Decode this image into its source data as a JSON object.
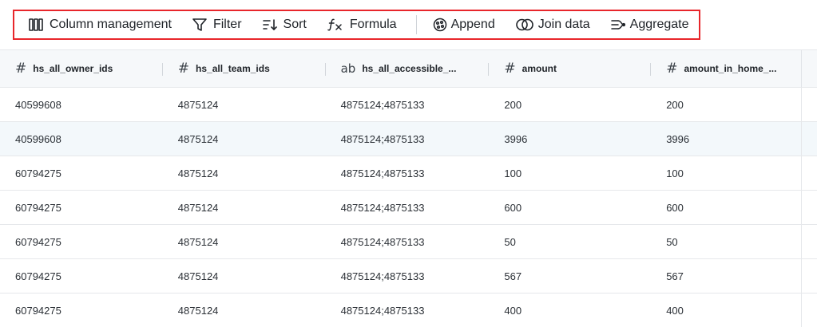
{
  "toolbar": {
    "column_management": "Column management",
    "filter": "Filter",
    "sort": "Sort",
    "formula": "Formula",
    "append": "Append",
    "join_data": "Join data",
    "aggregate": "Aggregate"
  },
  "columns": [
    {
      "type": "#",
      "name": "hs_all_owner_ids"
    },
    {
      "type": "#",
      "name": "hs_all_team_ids"
    },
    {
      "type": "ab",
      "name": "hs_all_accessible_..."
    },
    {
      "type": "#",
      "name": "amount"
    },
    {
      "type": "#",
      "name": "amount_in_home_..."
    }
  ],
  "rows": [
    [
      "40599608",
      "4875124",
      "4875124;4875133",
      "200",
      "200"
    ],
    [
      "40599608",
      "4875124",
      "4875124;4875133",
      "3996",
      "3996"
    ],
    [
      "60794275",
      "4875124",
      "4875124;4875133",
      "100",
      "100"
    ],
    [
      "60794275",
      "4875124",
      "4875124;4875133",
      "600",
      "600"
    ],
    [
      "60794275",
      "4875124",
      "4875124;4875133",
      "50",
      "50"
    ],
    [
      "60794275",
      "4875124",
      "4875124;4875133",
      "567",
      "567"
    ],
    [
      "60794275",
      "4875124",
      "4875124;4875133",
      "400",
      "400"
    ]
  ],
  "accent_color": "#e8262b"
}
